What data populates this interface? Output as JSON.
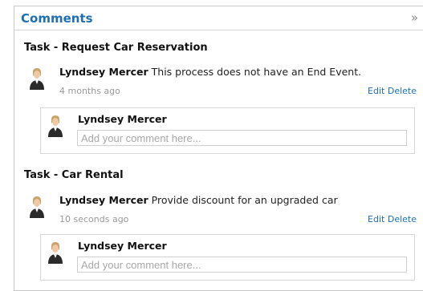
{
  "panel": {
    "title": "Comments",
    "collapse_glyph": "»"
  },
  "tasks": [
    {
      "title": "Task - Request Car Reservation",
      "comment": {
        "author": "Lyndsey Mercer",
        "text": " This process does not have an End Event.",
        "time": "4 months ago",
        "edit_label": "Edit",
        "delete_label": "Delete"
      },
      "reply": {
        "author": "Lyndsey Mercer",
        "placeholder": "Add your comment here..."
      }
    },
    {
      "title": "Task - Car Rental",
      "comment": {
        "author": "Lyndsey Mercer",
        "text": " Provide discount for an upgraded car",
        "time": "10 seconds ago",
        "edit_label": "Edit",
        "delete_label": "Delete"
      },
      "reply": {
        "author": "Lyndsey Mercer",
        "placeholder": "Add your comment here..."
      }
    }
  ],
  "icons": {
    "avatar": "user-avatar-icon",
    "collapse": "double-chevron-right-icon"
  },
  "colors": {
    "accent": "#1f6fb5",
    "muted": "#9a9a9a",
    "border": "#d6d6d6"
  }
}
